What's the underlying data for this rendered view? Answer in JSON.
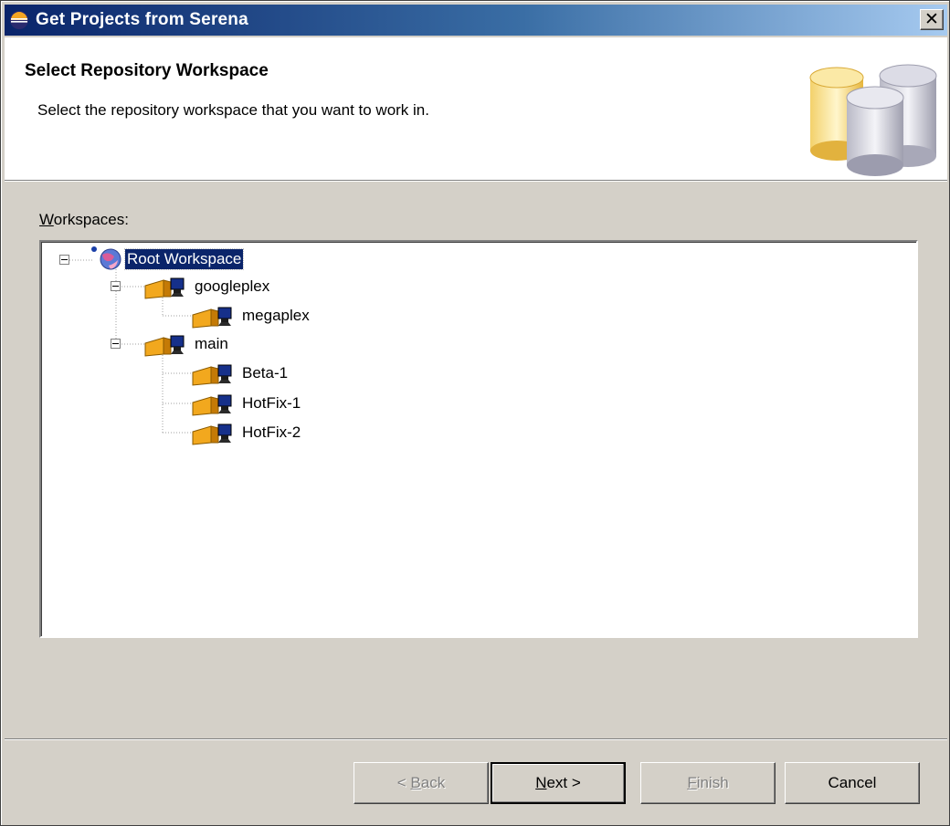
{
  "window": {
    "title": "Get Projects from Serena",
    "close_glyph": "✕"
  },
  "header": {
    "title": "Select Repository Workspace",
    "description": "Select the repository workspace that you want to work in."
  },
  "workspaces": {
    "label_mnemonic": "W",
    "label_rest": "orkspaces:"
  },
  "tree": {
    "root": {
      "label": "Root Workspace",
      "icon": "globe-icon",
      "selected": true,
      "expanded": true
    },
    "children": [
      {
        "label": "googleplex",
        "icon": "workspace-icon",
        "expanded": true,
        "children": [
          {
            "label": "megaplex",
            "icon": "workspace-icon"
          }
        ]
      },
      {
        "label": "main",
        "icon": "workspace-icon",
        "expanded": true,
        "children": [
          {
            "label": "Beta-1",
            "icon": "workspace-icon"
          },
          {
            "label": "HotFix-1",
            "icon": "workspace-icon"
          },
          {
            "label": "HotFix-2",
            "icon": "workspace-icon"
          }
        ]
      }
    ]
  },
  "buttons": {
    "back": {
      "prefix": "< ",
      "mnemonic": "B",
      "rest": "ack",
      "enabled": false
    },
    "next": {
      "prefix": "",
      "mnemonic": "N",
      "rest": "ext >",
      "enabled": true
    },
    "finish": {
      "prefix": "",
      "mnemonic": "F",
      "rest": "inish",
      "enabled": false
    },
    "cancel": {
      "label": "Cancel",
      "enabled": true
    }
  },
  "colors": {
    "titlebar_start": "#0a246a",
    "titlebar_end": "#a6caf0",
    "dialog_bg": "#d4d0c8",
    "selection": "#0a246a"
  }
}
